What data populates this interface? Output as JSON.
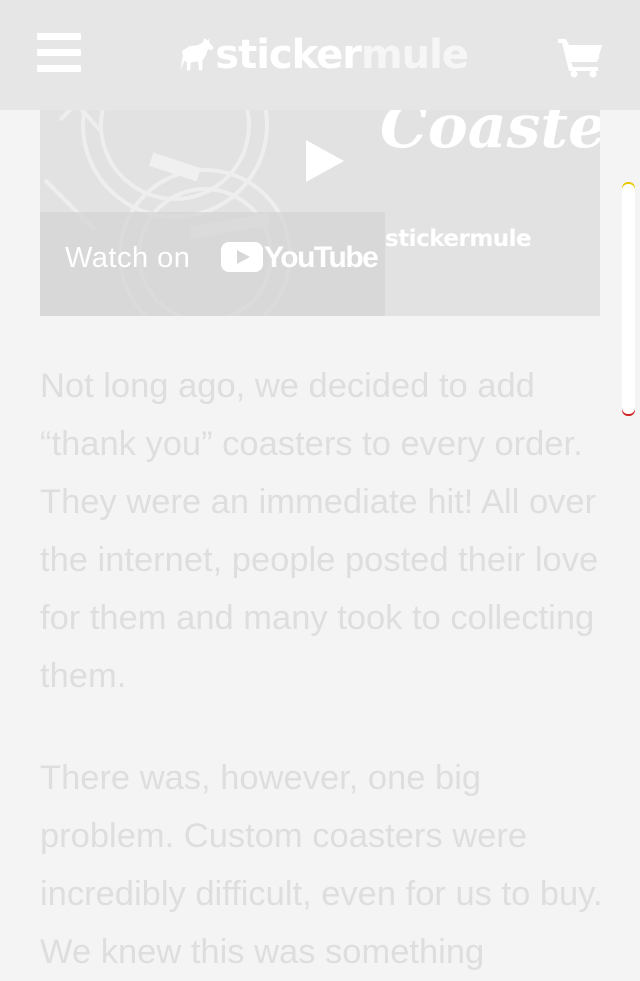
{
  "header": {
    "brand_part1": "sticker",
    "brand_part2": "mule",
    "icons": {
      "menu": "hamburger-icon",
      "cart": "shopping-cart-icon",
      "logo": "mule-icon"
    }
  },
  "video": {
    "watch_label": "Watch on",
    "youtube_label": "YouTube",
    "title_overlay": "Coasters",
    "brand_overlay": "stickermule",
    "icons": {
      "play": "play-icon",
      "youtube": "youtube-icon"
    }
  },
  "article": {
    "paragraphs": [
      "Not long ago, we decided to add “thank you” coasters to every order. They were an immediate hit! All over the internet, people posted their love for them and many took to collecting them.",
      "There was, however, one big problem. Custom coasters were incredibly difficult, even for us to buy. We knew this was something"
    ]
  },
  "colors": {
    "header_bg": "#e6e6e6",
    "page_bg": "#f4f4f4",
    "text": "#dedede"
  }
}
